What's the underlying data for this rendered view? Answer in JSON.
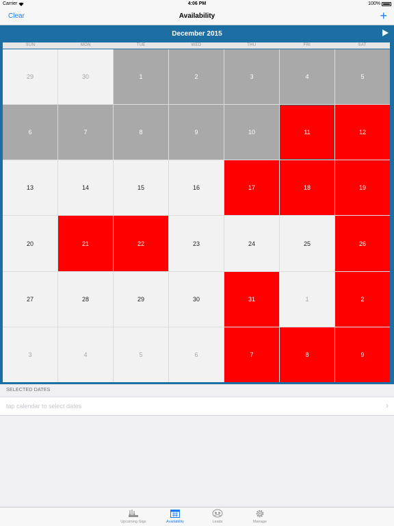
{
  "status_bar": {
    "carrier": "Carrier",
    "time": "4:06 PM",
    "battery": "100%"
  },
  "nav": {
    "clear_label": "Clear",
    "title": "Availability",
    "add_label": "+"
  },
  "calendar": {
    "month_label": "December 2015",
    "weekdays": [
      "SUN",
      "MON",
      "TUE",
      "WED",
      "THU",
      "FRI",
      "SAT"
    ],
    "days": [
      {
        "label": "29",
        "state": "other"
      },
      {
        "label": "30",
        "state": "other"
      },
      {
        "label": "1",
        "state": "past"
      },
      {
        "label": "2",
        "state": "past"
      },
      {
        "label": "3",
        "state": "past"
      },
      {
        "label": "4",
        "state": "past"
      },
      {
        "label": "5",
        "state": "past"
      },
      {
        "label": "6",
        "state": "past"
      },
      {
        "label": "7",
        "state": "past"
      },
      {
        "label": "8",
        "state": "past"
      },
      {
        "label": "9",
        "state": "past"
      },
      {
        "label": "10",
        "state": "past"
      },
      {
        "label": "11",
        "state": "booked",
        "today": true
      },
      {
        "label": "12",
        "state": "booked"
      },
      {
        "label": "13",
        "state": "avail"
      },
      {
        "label": "14",
        "state": "avail"
      },
      {
        "label": "15",
        "state": "avail"
      },
      {
        "label": "16",
        "state": "avail"
      },
      {
        "label": "17",
        "state": "booked"
      },
      {
        "label": "18",
        "state": "booked"
      },
      {
        "label": "19",
        "state": "booked"
      },
      {
        "label": "20",
        "state": "avail"
      },
      {
        "label": "21",
        "state": "booked"
      },
      {
        "label": "22",
        "state": "booked"
      },
      {
        "label": "23",
        "state": "avail"
      },
      {
        "label": "24",
        "state": "avail"
      },
      {
        "label": "25",
        "state": "avail"
      },
      {
        "label": "26",
        "state": "booked"
      },
      {
        "label": "27",
        "state": "avail"
      },
      {
        "label": "28",
        "state": "avail"
      },
      {
        "label": "29",
        "state": "avail"
      },
      {
        "label": "30",
        "state": "avail"
      },
      {
        "label": "31",
        "state": "booked"
      },
      {
        "label": "1",
        "state": "other"
      },
      {
        "label": "2",
        "state": "booked"
      },
      {
        "label": "3",
        "state": "other"
      },
      {
        "label": "4",
        "state": "other"
      },
      {
        "label": "5",
        "state": "other"
      },
      {
        "label": "6",
        "state": "other"
      },
      {
        "label": "7",
        "state": "booked"
      },
      {
        "label": "8",
        "state": "booked"
      },
      {
        "label": "9",
        "state": "booked"
      }
    ]
  },
  "selected": {
    "header": "SELECTED DATES",
    "placeholder": "tap calendar to select dates"
  },
  "tabs": [
    {
      "label": "Upcoming Gigs",
      "icon": "upcoming-gigs-icon",
      "active": false
    },
    {
      "label": "Availability",
      "icon": "calendar-icon",
      "active": true
    },
    {
      "label": "Leads",
      "icon": "leads-icon",
      "active": false
    },
    {
      "label": "Manage",
      "icon": "gear-icon",
      "active": false
    }
  ],
  "colors": {
    "accent": "#1a7cf6",
    "calendar_frame": "#1d6fa3",
    "booked": "#ff0000",
    "past": "#a9a9a9",
    "available": "#f2f2f2"
  }
}
